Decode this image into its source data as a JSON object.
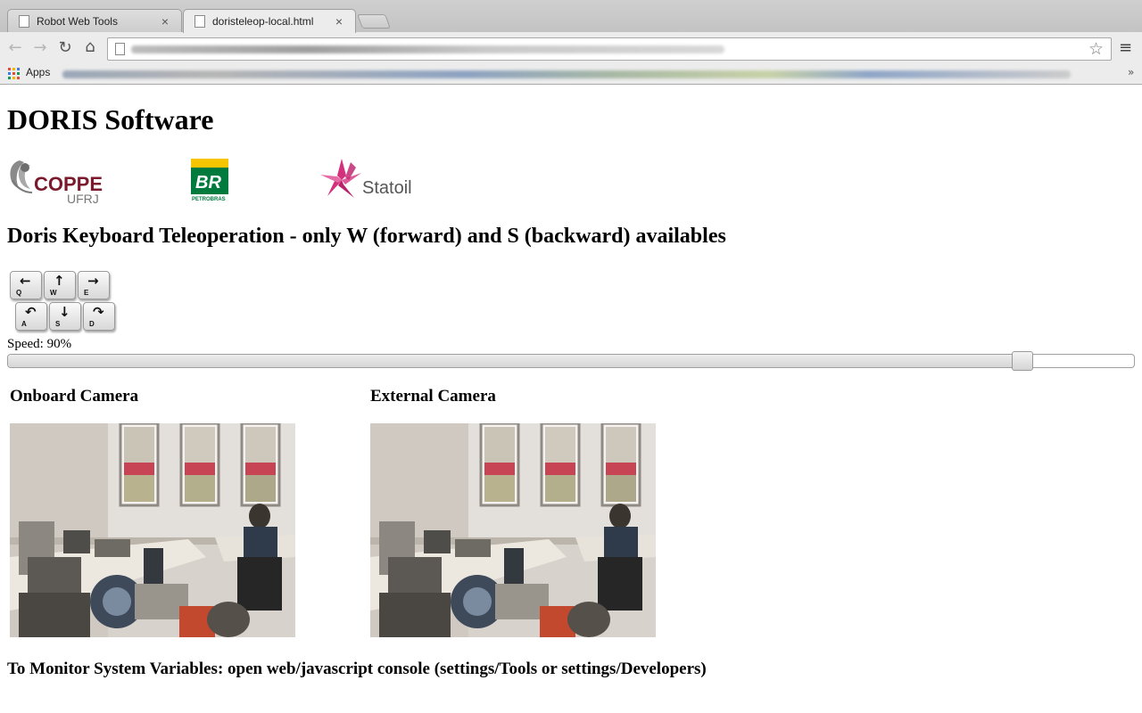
{
  "browser": {
    "tabs": [
      {
        "title": "Robot Web Tools",
        "active": false,
        "close": "×"
      },
      {
        "title": "doristeleop-local.html",
        "active": true,
        "close": "×"
      }
    ],
    "nav": {
      "back": "←",
      "forward": "→",
      "reload": "↻",
      "home": "⌂",
      "star": "☆",
      "menu": "≡"
    },
    "bookmarks": {
      "apps_label": "Apps",
      "more": "»"
    }
  },
  "page": {
    "title": "DORIS Software",
    "logos": {
      "coppe": {
        "main": "COPPE",
        "sub": "UFRJ"
      },
      "petrobras": {
        "mark": "BR",
        "sub": "PETROBRAS"
      },
      "statoil": {
        "name": "Statoil"
      }
    },
    "teleop_heading": "Doris Keyboard Teleoperation - only W (forward) and S (backward) availables",
    "keys": [
      {
        "letter": "Q",
        "arrow": "←"
      },
      {
        "letter": "W",
        "arrow": "↑"
      },
      {
        "letter": "E",
        "arrow": "→"
      },
      {
        "letter": "A",
        "arrow": "↶"
      },
      {
        "letter": "S",
        "arrow": "↓"
      },
      {
        "letter": "D",
        "arrow": "↷"
      }
    ],
    "speed": {
      "label": "Speed: 90%",
      "value_percent": 90
    },
    "cameras": [
      {
        "label": "Onboard Camera"
      },
      {
        "label": "External Camera"
      }
    ],
    "monitor_text": "To Monitor System Variables: open web/javascript console (settings/Tools or settings/Developers)"
  },
  "colors": {
    "coppe": "#7b1a2c",
    "petrobras_green": "#007a3d",
    "petrobras_yellow": "#f7c600",
    "statoil": "#d4317d"
  }
}
